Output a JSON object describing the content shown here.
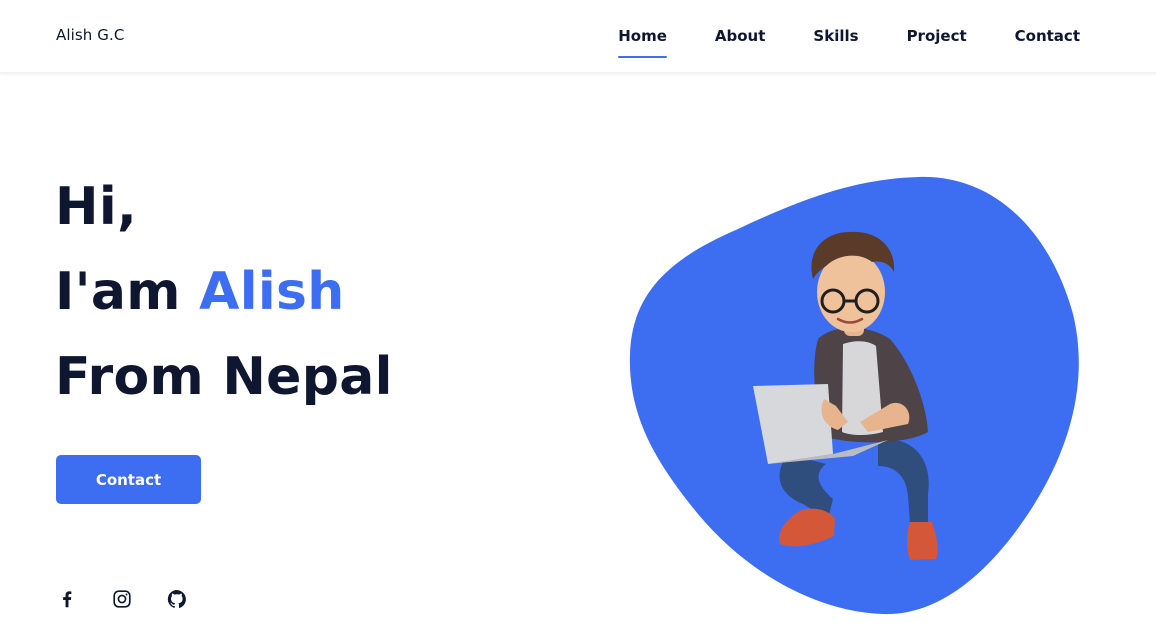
{
  "header": {
    "logo": "Alish G.C",
    "nav": [
      {
        "label": "Home",
        "active": true
      },
      {
        "label": "About",
        "active": false
      },
      {
        "label": "Skills",
        "active": false
      },
      {
        "label": "Project",
        "active": false
      },
      {
        "label": "Contact",
        "active": false
      }
    ]
  },
  "hero": {
    "line1": "Hi,",
    "line2_prefix": "I'am ",
    "line2_name": "Alish",
    "line3": "From Nepal",
    "button_label": "Contact"
  },
  "social": {
    "icons": [
      "facebook-icon",
      "instagram-icon",
      "github-icon"
    ]
  },
  "colors": {
    "accent": "#3d6ef2",
    "text": "#0e1630",
    "background": "#ffffff"
  }
}
